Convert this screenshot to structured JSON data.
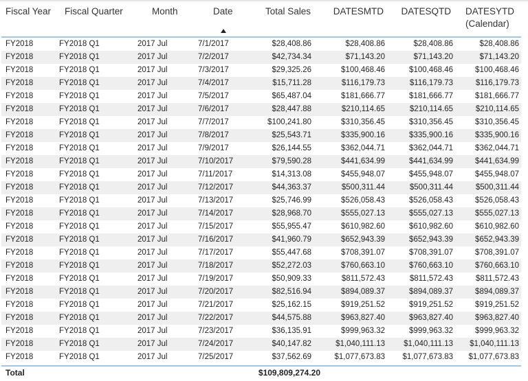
{
  "columns": [
    "Fiscal Year",
    "Fiscal Quarter",
    "Month",
    "Date",
    "Total Sales",
    "DATESMTD",
    "DATESQTD",
    "DATESYTD",
    "(Calendar)"
  ],
  "sort": {
    "column": "Date",
    "direction": "ascending",
    "icon": "sort-ascending-icon"
  },
  "rows": [
    [
      "FY2018",
      "FY2018 Q1",
      "2017 Jul",
      "7/1/2017",
      "$28,408.86",
      "$28,408.86",
      "$28,408.86",
      "$28,408.86"
    ],
    [
      "FY2018",
      "FY2018 Q1",
      "2017 Jul",
      "7/2/2017",
      "$42,734.34",
      "$71,143.20",
      "$71,143.20",
      "$71,143.20"
    ],
    [
      "FY2018",
      "FY2018 Q1",
      "2017 Jul",
      "7/3/2017",
      "$29,325.26",
      "$100,468.46",
      "$100,468.46",
      "$100,468.46"
    ],
    [
      "FY2018",
      "FY2018 Q1",
      "2017 Jul",
      "7/4/2017",
      "$15,711.28",
      "$116,179.73",
      "$116,179.73",
      "$116,179.73"
    ],
    [
      "FY2018",
      "FY2018 Q1",
      "2017 Jul",
      "7/5/2017",
      "$65,487.04",
      "$181,666.77",
      "$181,666.77",
      "$181,666.77"
    ],
    [
      "FY2018",
      "FY2018 Q1",
      "2017 Jul",
      "7/6/2017",
      "$28,447.88",
      "$210,114.65",
      "$210,114.65",
      "$210,114.65"
    ],
    [
      "FY2018",
      "FY2018 Q1",
      "2017 Jul",
      "7/7/2017",
      "$100,241.80",
      "$310,356.45",
      "$310,356.45",
      "$310,356.45"
    ],
    [
      "FY2018",
      "FY2018 Q1",
      "2017 Jul",
      "7/8/2017",
      "$25,543.71",
      "$335,900.16",
      "$335,900.16",
      "$335,900.16"
    ],
    [
      "FY2018",
      "FY2018 Q1",
      "2017 Jul",
      "7/9/2017",
      "$26,144.55",
      "$362,044.71",
      "$362,044.71",
      "$362,044.71"
    ],
    [
      "FY2018",
      "FY2018 Q1",
      "2017 Jul",
      "7/10/2017",
      "$79,590.28",
      "$441,634.99",
      "$441,634.99",
      "$441,634.99"
    ],
    [
      "FY2018",
      "FY2018 Q1",
      "2017 Jul",
      "7/11/2017",
      "$14,313.08",
      "$455,948.07",
      "$455,948.07",
      "$455,948.07"
    ],
    [
      "FY2018",
      "FY2018 Q1",
      "2017 Jul",
      "7/12/2017",
      "$44,363.37",
      "$500,311.44",
      "$500,311.44",
      "$500,311.44"
    ],
    [
      "FY2018",
      "FY2018 Q1",
      "2017 Jul",
      "7/13/2017",
      "$25,746.99",
      "$526,058.43",
      "$526,058.43",
      "$526,058.43"
    ],
    [
      "FY2018",
      "FY2018 Q1",
      "2017 Jul",
      "7/14/2017",
      "$28,968.70",
      "$555,027.13",
      "$555,027.13",
      "$555,027.13"
    ],
    [
      "FY2018",
      "FY2018 Q1",
      "2017 Jul",
      "7/15/2017",
      "$55,955.47",
      "$610,982.60",
      "$610,982.60",
      "$610,982.60"
    ],
    [
      "FY2018",
      "FY2018 Q1",
      "2017 Jul",
      "7/16/2017",
      "$41,960.79",
      "$652,943.39",
      "$652,943.39",
      "$652,943.39"
    ],
    [
      "FY2018",
      "FY2018 Q1",
      "2017 Jul",
      "7/17/2017",
      "$55,447.68",
      "$708,391.07",
      "$708,391.07",
      "$708,391.07"
    ],
    [
      "FY2018",
      "FY2018 Q1",
      "2017 Jul",
      "7/18/2017",
      "$52,272.03",
      "$760,663.10",
      "$760,663.10",
      "$760,663.10"
    ],
    [
      "FY2018",
      "FY2018 Q1",
      "2017 Jul",
      "7/19/2017",
      "$50,909.33",
      "$811,572.43",
      "$811,572.43",
      "$811,572.43"
    ],
    [
      "FY2018",
      "FY2018 Q1",
      "2017 Jul",
      "7/20/2017",
      "$82,516.94",
      "$894,089.37",
      "$894,089.37",
      "$894,089.37"
    ],
    [
      "FY2018",
      "FY2018 Q1",
      "2017 Jul",
      "7/21/2017",
      "$25,162.15",
      "$919,251.52",
      "$919,251.52",
      "$919,251.52"
    ],
    [
      "FY2018",
      "FY2018 Q1",
      "2017 Jul",
      "7/22/2017",
      "$44,575.88",
      "$963,827.40",
      "$963,827.40",
      "$963,827.40"
    ],
    [
      "FY2018",
      "FY2018 Q1",
      "2017 Jul",
      "7/23/2017",
      "$36,135.91",
      "$999,963.32",
      "$999,963.32",
      "$999,963.32"
    ],
    [
      "FY2018",
      "FY2018 Q1",
      "2017 Jul",
      "7/24/2017",
      "$40,147.82",
      "$1,040,111.13",
      "$1,040,111.13",
      "$1,040,111.13"
    ],
    [
      "FY2018",
      "FY2018 Q1",
      "2017 Jul",
      "7/25/2017",
      "$37,562.69",
      "$1,077,673.83",
      "$1,077,673.83",
      "$1,077,673.83"
    ]
  ],
  "total": {
    "label": "Total",
    "total_sales": "$109,809,274.20"
  },
  "colors": {
    "accent": "#9cc8ec",
    "alt_row": "#efefef"
  }
}
